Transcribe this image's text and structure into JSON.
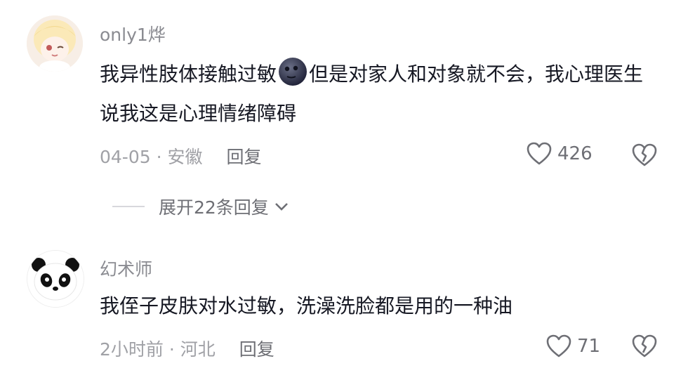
{
  "comments": [
    {
      "username": "only1烨",
      "text_before_emoji": "我异性肢体接触过敏",
      "emoji": "new-moon-face-icon",
      "text_after_emoji": "但是对家人和对象就不会，我心理医生说我这是心理情绪障碍",
      "meta": "04-05 · 安徽",
      "reply_label": "回复",
      "likes": "426",
      "expand_label": "展开22条回复"
    },
    {
      "username": "幻术师",
      "text": "我侄子皮肤对水过敏，洗澡洗脸都是用的一种油",
      "meta": "2小时前 · 河北",
      "reply_label": "回复",
      "likes": "71"
    }
  ],
  "colors": {
    "text": "#161823",
    "secondary": "#8a8b91",
    "muted": "#a0a1a6"
  }
}
